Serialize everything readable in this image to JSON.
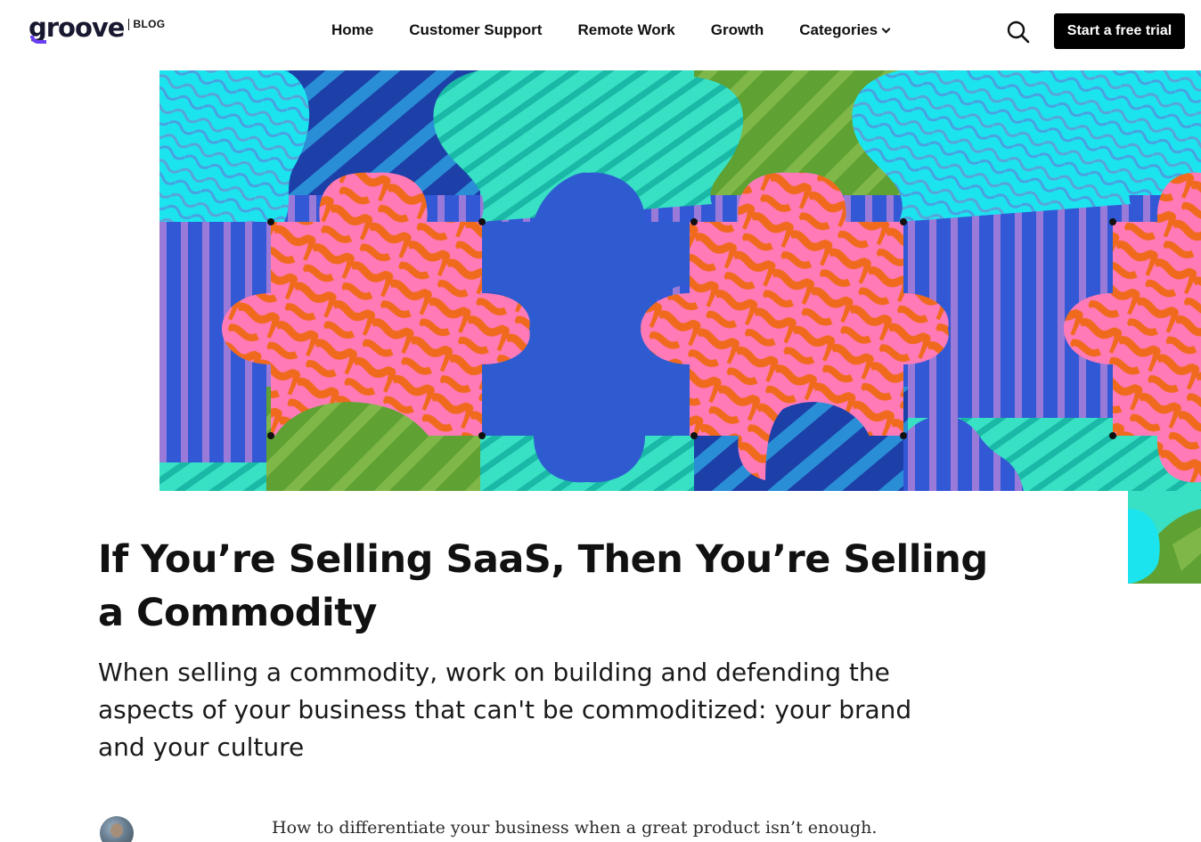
{
  "header": {
    "logo": {
      "wordmark": "groove",
      "tag": "BLOG",
      "brand_color": "#181830",
      "accent_color": "#6a3ff5"
    },
    "nav": [
      {
        "label": "Home"
      },
      {
        "label": "Customer Support"
      },
      {
        "label": "Remote Work"
      },
      {
        "label": "Growth"
      },
      {
        "label": "Categories",
        "has_dropdown": true
      }
    ],
    "search_icon": "search-icon",
    "cta_label": "Start a free trial"
  },
  "hero": {
    "palette": {
      "teal": "#2dd6c0",
      "cyan": "#19e3ee",
      "blue": "#2f5bd1",
      "navy": "#1c3fa8",
      "green": "#5fa133",
      "pink": "#ff7ab7",
      "orange": "#f06a1e",
      "purple": "#8a6bd8"
    }
  },
  "article": {
    "title": "If You’re Selling SaaS, Then You’re Selling a Commodity",
    "subtitle": "When selling a commodity, work on building and defending the aspects of your business that can't be commoditized: your brand and your culture",
    "lede": "How to differentiate your business when a great product isn’t enough."
  }
}
